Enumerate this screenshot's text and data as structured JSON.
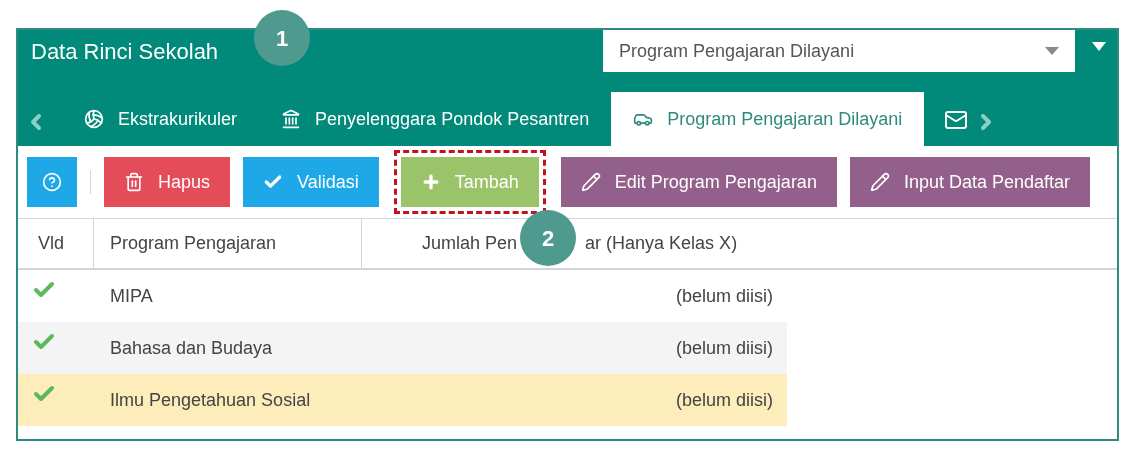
{
  "header": {
    "title": "Data Rinci Sekolah",
    "dropdown": {
      "value": "Program Pengajaran Dilayani"
    }
  },
  "tabs": [
    {
      "label": "Ekstrakurikuler",
      "selected": false
    },
    {
      "label": "Penyelenggara Pondok Pesantren",
      "selected": false
    },
    {
      "label": "Program Pengajaran Dilayani",
      "selected": true
    }
  ],
  "toolbar": [
    {
      "kind": "help"
    },
    {
      "kind": "delete",
      "label": "Hapus"
    },
    {
      "kind": "validate",
      "label": "Validasi"
    },
    {
      "kind": "add",
      "label": "Tambah",
      "highlighted": true
    },
    {
      "kind": "edit",
      "label": "Edit Program Pengajaran"
    },
    {
      "kind": "edit",
      "label": "Input Data Pendaftar"
    }
  ],
  "table": {
    "columns": [
      "Vld",
      "Program Pengajaran",
      {
        "parts": [
          "Jumlah Pen",
          "ar (Hanya Kelas X)"
        ]
      }
    ],
    "rows": [
      {
        "validated": true,
        "program": "MIPA",
        "jumlah": "(belum diisi)",
        "selected": false
      },
      {
        "validated": true,
        "program": "Bahasa dan Budaya",
        "jumlah": "(belum diisi)",
        "selected": false
      },
      {
        "validated": true,
        "program": "Ilmu Pengetahuan Sosial",
        "jumlah": "(belum diisi)",
        "selected": true
      }
    ]
  },
  "callouts": [
    "1",
    "2"
  ]
}
